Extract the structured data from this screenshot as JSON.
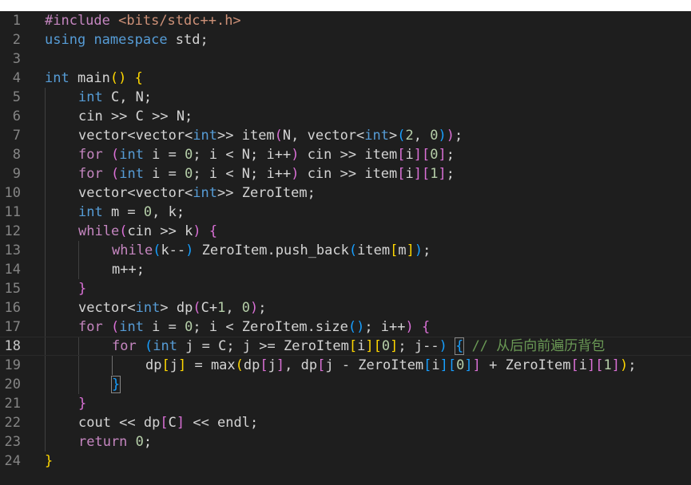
{
  "editor": {
    "active_line": 18,
    "lines": [
      {
        "n": "1",
        "indent": 0,
        "tokens": [
          [
            "prep",
            "#include"
          ],
          [
            "txt",
            " "
          ],
          [
            "inc",
            "<bits/stdc++.h>"
          ]
        ]
      },
      {
        "n": "2",
        "indent": 0,
        "tokens": [
          [
            "kw",
            "using"
          ],
          [
            "txt",
            " "
          ],
          [
            "kw",
            "namespace"
          ],
          [
            "txt",
            " std;"
          ]
        ]
      },
      {
        "n": "3",
        "indent": 0,
        "tokens": []
      },
      {
        "n": "4",
        "indent": 0,
        "tokens": [
          [
            "kw",
            "int"
          ],
          [
            "txt",
            " main"
          ],
          [
            "b1",
            "()"
          ],
          [
            "txt",
            " "
          ],
          [
            "b1",
            "{"
          ]
        ]
      },
      {
        "n": "5",
        "indent": 1,
        "tokens": [
          [
            "kw",
            "int"
          ],
          [
            "txt",
            " C, N;"
          ]
        ]
      },
      {
        "n": "6",
        "indent": 1,
        "tokens": [
          [
            "txt",
            "cin >> C >> N;"
          ]
        ]
      },
      {
        "n": "7",
        "indent": 1,
        "tokens": [
          [
            "txt",
            "vector<vector<"
          ],
          [
            "kw",
            "int"
          ],
          [
            "txt",
            ">> item"
          ],
          [
            "b2",
            "("
          ],
          [
            "txt",
            "N, vector<"
          ],
          [
            "kw",
            "int"
          ],
          [
            "txt",
            ">"
          ],
          [
            "b3",
            "("
          ],
          [
            "num",
            "2"
          ],
          [
            "txt",
            ", "
          ],
          [
            "num",
            "0"
          ],
          [
            "b3",
            ")"
          ],
          [
            "b2",
            ")"
          ],
          [
            "txt",
            ";"
          ]
        ]
      },
      {
        "n": "8",
        "indent": 1,
        "tokens": [
          [
            "ctl",
            "for"
          ],
          [
            "txt",
            " "
          ],
          [
            "b2",
            "("
          ],
          [
            "kw",
            "int"
          ],
          [
            "txt",
            " i = "
          ],
          [
            "num",
            "0"
          ],
          [
            "txt",
            "; i < N; i++"
          ],
          [
            "b2",
            ")"
          ],
          [
            "txt",
            " cin >> item"
          ],
          [
            "b2",
            "["
          ],
          [
            "txt",
            "i"
          ],
          [
            "b2",
            "]"
          ],
          [
            "b2",
            "["
          ],
          [
            "num",
            "0"
          ],
          [
            "b2",
            "]"
          ],
          [
            "txt",
            ";"
          ]
        ]
      },
      {
        "n": "9",
        "indent": 1,
        "tokens": [
          [
            "ctl",
            "for"
          ],
          [
            "txt",
            " "
          ],
          [
            "b2",
            "("
          ],
          [
            "kw",
            "int"
          ],
          [
            "txt",
            " i = "
          ],
          [
            "num",
            "0"
          ],
          [
            "txt",
            "; i < N; i++"
          ],
          [
            "b2",
            ")"
          ],
          [
            "txt",
            " cin >> item"
          ],
          [
            "b2",
            "["
          ],
          [
            "txt",
            "i"
          ],
          [
            "b2",
            "]"
          ],
          [
            "b2",
            "["
          ],
          [
            "num",
            "1"
          ],
          [
            "b2",
            "]"
          ],
          [
            "txt",
            ";"
          ]
        ]
      },
      {
        "n": "10",
        "indent": 1,
        "tokens": [
          [
            "txt",
            "vector<vector<"
          ],
          [
            "kw",
            "int"
          ],
          [
            "txt",
            ">> ZeroItem;"
          ]
        ]
      },
      {
        "n": "11",
        "indent": 1,
        "tokens": [
          [
            "kw",
            "int"
          ],
          [
            "txt",
            " m = "
          ],
          [
            "num",
            "0"
          ],
          [
            "txt",
            ", k;"
          ]
        ]
      },
      {
        "n": "12",
        "indent": 1,
        "tokens": [
          [
            "ctl",
            "while"
          ],
          [
            "b2",
            "("
          ],
          [
            "txt",
            "cin >> k"
          ],
          [
            "b2",
            ")"
          ],
          [
            "txt",
            " "
          ],
          [
            "b2",
            "{"
          ]
        ]
      },
      {
        "n": "13",
        "indent": 2,
        "tokens": [
          [
            "ctl",
            "while"
          ],
          [
            "b3",
            "("
          ],
          [
            "txt",
            "k--"
          ],
          [
            "b3",
            ")"
          ],
          [
            "txt",
            " ZeroItem.push_back"
          ],
          [
            "b3",
            "("
          ],
          [
            "txt",
            "item"
          ],
          [
            "b1",
            "["
          ],
          [
            "txt",
            "m"
          ],
          [
            "b1",
            "]"
          ],
          [
            "b3",
            ")"
          ],
          [
            "txt",
            ";"
          ]
        ]
      },
      {
        "n": "14",
        "indent": 2,
        "tokens": [
          [
            "txt",
            "m++;"
          ]
        ]
      },
      {
        "n": "15",
        "indent": 1,
        "tokens": [
          [
            "b2",
            "}"
          ]
        ]
      },
      {
        "n": "16",
        "indent": 1,
        "tokens": [
          [
            "txt",
            "vector<"
          ],
          [
            "kw",
            "int"
          ],
          [
            "txt",
            "> dp"
          ],
          [
            "b2",
            "("
          ],
          [
            "txt",
            "C+"
          ],
          [
            "num",
            "1"
          ],
          [
            "txt",
            ", "
          ],
          [
            "num",
            "0"
          ],
          [
            "b2",
            ")"
          ],
          [
            "txt",
            ";"
          ]
        ]
      },
      {
        "n": "17",
        "indent": 1,
        "tokens": [
          [
            "ctl",
            "for"
          ],
          [
            "txt",
            " "
          ],
          [
            "b2",
            "("
          ],
          [
            "kw",
            "int"
          ],
          [
            "txt",
            " i = "
          ],
          [
            "num",
            "0"
          ],
          [
            "txt",
            "; i < ZeroItem.size"
          ],
          [
            "b3",
            "()"
          ],
          [
            "txt",
            "; i++"
          ],
          [
            "b2",
            ")"
          ],
          [
            "txt",
            " "
          ],
          [
            "b2",
            "{"
          ]
        ]
      },
      {
        "n": "18",
        "indent": 2,
        "tokens": [
          [
            "ctl",
            "for"
          ],
          [
            "txt",
            " "
          ],
          [
            "b3",
            "("
          ],
          [
            "kw",
            "int"
          ],
          [
            "txt",
            " j = C; j >= ZeroItem"
          ],
          [
            "b1",
            "["
          ],
          [
            "txt",
            "i"
          ],
          [
            "b1",
            "]"
          ],
          [
            "b1",
            "["
          ],
          [
            "num",
            "0"
          ],
          [
            "b1",
            "]"
          ],
          [
            "txt",
            "; j--"
          ],
          [
            "b3",
            ")"
          ],
          [
            "txt",
            " "
          ],
          [
            "b3 bm",
            "{"
          ],
          [
            "txt",
            " "
          ],
          [
            "cmt",
            "// 从后向前遍历背包"
          ]
        ]
      },
      {
        "n": "19",
        "indent": 3,
        "tokens": [
          [
            "txt",
            "dp"
          ],
          [
            "b1",
            "["
          ],
          [
            "txt",
            "j"
          ],
          [
            "b1",
            "]"
          ],
          [
            "txt",
            " = max"
          ],
          [
            "b1",
            "("
          ],
          [
            "txt",
            "dp"
          ],
          [
            "b2",
            "["
          ],
          [
            "txt",
            "j"
          ],
          [
            "b2",
            "]"
          ],
          [
            "txt",
            ", dp"
          ],
          [
            "b2",
            "["
          ],
          [
            "txt",
            "j - ZeroItem"
          ],
          [
            "b3",
            "["
          ],
          [
            "txt",
            "i"
          ],
          [
            "b3",
            "]"
          ],
          [
            "b3",
            "["
          ],
          [
            "num",
            "0"
          ],
          [
            "b3",
            "]"
          ],
          [
            "b2",
            "]"
          ],
          [
            "txt",
            " + ZeroItem"
          ],
          [
            "b2",
            "["
          ],
          [
            "txt",
            "i"
          ],
          [
            "b2",
            "]"
          ],
          [
            "b2",
            "["
          ],
          [
            "num",
            "1"
          ],
          [
            "b2",
            "]"
          ],
          [
            "b1",
            ")"
          ],
          [
            "txt",
            ";"
          ]
        ]
      },
      {
        "n": "20",
        "indent": 2,
        "tokens": [
          [
            "b3 bm",
            "}"
          ]
        ]
      },
      {
        "n": "21",
        "indent": 1,
        "tokens": [
          [
            "b2",
            "}"
          ]
        ]
      },
      {
        "n": "22",
        "indent": 1,
        "tokens": [
          [
            "txt",
            "cout << dp"
          ],
          [
            "b2",
            "["
          ],
          [
            "txt",
            "C"
          ],
          [
            "b2",
            "]"
          ],
          [
            "txt",
            " << endl;"
          ]
        ]
      },
      {
        "n": "23",
        "indent": 1,
        "tokens": [
          [
            "ctl",
            "return"
          ],
          [
            "txt",
            " "
          ],
          [
            "num",
            "0"
          ],
          [
            "txt",
            ";"
          ]
        ]
      },
      {
        "n": "24",
        "indent": 0,
        "tokens": [
          [
            "b1",
            "}"
          ]
        ]
      }
    ]
  }
}
